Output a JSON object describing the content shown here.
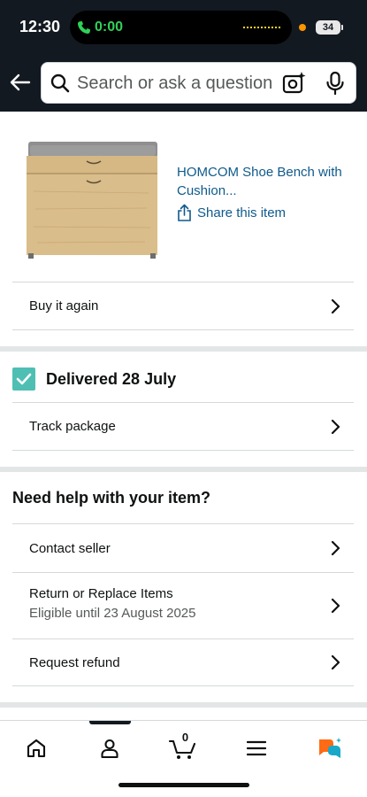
{
  "status_bar": {
    "time": "12:30",
    "call_timer": "0:00",
    "battery": "34",
    "call_color": "#30d158",
    "recording_dot_color": "#ff9500"
  },
  "header": {
    "background_color": "#131921",
    "search": {
      "placeholder": "Search or ask a question",
      "value": ""
    },
    "icons": [
      "back-arrow-icon",
      "search-icon",
      "camera-lens-icon",
      "microphone-icon"
    ]
  },
  "product": {
    "title": "HOMCOM Shoe Bench with Cushion...",
    "share_label": "Share this item",
    "image_icon": "shoe-bench-image",
    "link_color": "#0f5a8c"
  },
  "actions": {
    "buy_again": "Buy it again"
  },
  "delivery": {
    "status": "Delivered 28 July",
    "track_label": "Track package",
    "check_color": "#4fbfb4"
  },
  "help": {
    "title": "Need help with your item?",
    "contact_seller": "Contact seller",
    "return_replace": "Return or Replace Items",
    "return_eligibility": "Eligible until 23 August 2025",
    "request_refund": "Request refund"
  },
  "bottom_nav": {
    "items": [
      "home-icon",
      "account-icon",
      "cart-icon",
      "menu-icon",
      "rufus-assistant-icon"
    ],
    "cart_count": "0",
    "active_item": "account-icon",
    "rufus_colors": [
      "#ff6a14",
      "#1aa8c9"
    ]
  }
}
